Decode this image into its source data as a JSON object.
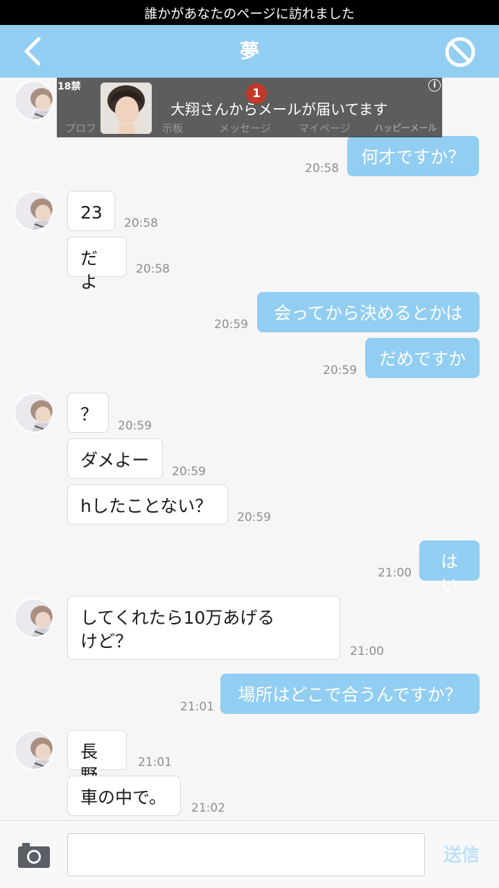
{
  "notification": {
    "text": "誰かがあなたのページに訪れました"
  },
  "header": {
    "title": "夢"
  },
  "ad": {
    "age_label": "18禁",
    "info_icon": "i",
    "message": "大翔さんからメールが届いてます",
    "badge_count": "1",
    "tabs": [
      "プロフ",
      "示板",
      "メッセージ",
      "マイページ",
      "ハッピーメール"
    ]
  },
  "messages": [
    {
      "side": "right",
      "text": "何才ですか？",
      "time": "20:58"
    },
    {
      "side": "left",
      "text": "23",
      "time": "20:58"
    },
    {
      "side": "left",
      "text": "だよ",
      "time": "20:58"
    },
    {
      "side": "right",
      "text": "会ってから決めるとかは",
      "time": "20:59"
    },
    {
      "side": "right",
      "text": "だめですか",
      "time": "20:59"
    },
    {
      "side": "left",
      "text": "？",
      "time": "20:59"
    },
    {
      "side": "left",
      "text": "ダメよー",
      "time": "20:59"
    },
    {
      "side": "left",
      "text": "hしたことない？",
      "time": "20:59"
    },
    {
      "side": "right",
      "text": "はい",
      "time": "21:00"
    },
    {
      "side": "left",
      "text": "してくれたら10万あげる\nけど？",
      "time": "21:00"
    },
    {
      "side": "right",
      "text": "場所はどこで合うんですか？",
      "time": "21:01"
    },
    {
      "side": "left",
      "text": "長野",
      "time": "21:01"
    },
    {
      "side": "left",
      "text": "車の中で。",
      "time": "21:02"
    }
  ],
  "composer": {
    "input_value": "",
    "send_label": "送信"
  },
  "colors": {
    "accent": "#92cdf2",
    "send_disabled": "#bfe1f6"
  }
}
